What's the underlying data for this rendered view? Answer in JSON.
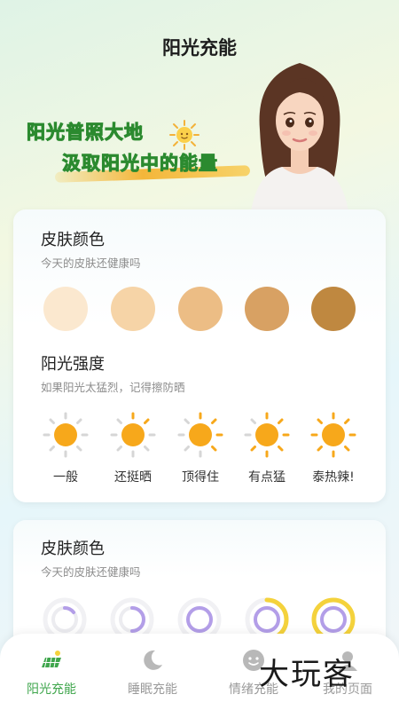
{
  "header": {
    "title": "阳光充能"
  },
  "hero": {
    "line1": "阳光普照大地",
    "line2": "汲取阳光中的能量"
  },
  "skin_section": {
    "title": "皮肤颜色",
    "subtitle": "今天的皮肤还健康吗",
    "swatch_colors": [
      "#fbe8cf",
      "#f6d4a7",
      "#ecbd85",
      "#d8a163",
      "#bf8840"
    ]
  },
  "sun_section": {
    "title": "阳光强度",
    "subtitle": "如果阳光太猛烈，记得擦防晒",
    "levels": [
      "一般",
      "还挺晒",
      "顶得住",
      "有点猛",
      "泰热辣!"
    ]
  },
  "skin_section_2": {
    "title": "皮肤颜色",
    "subtitle": "今天的皮肤还健康吗"
  },
  "tabs": [
    {
      "label": "阳光充能",
      "icon": "solar-panel-icon",
      "active": true
    },
    {
      "label": "睡眠充能",
      "icon": "moon-sleep-icon",
      "active": false
    },
    {
      "label": "情绪充能",
      "icon": "smiley-icon",
      "active": false
    },
    {
      "label": "我的页面",
      "icon": "profile-icon",
      "active": false
    }
  ],
  "watermark": "大玩客",
  "colors": {
    "accent_green": "#3fa64c",
    "sun_orange": "#f7a81b",
    "ring_purple": "#b39ee8",
    "ring_yellow": "#f4d23c"
  }
}
